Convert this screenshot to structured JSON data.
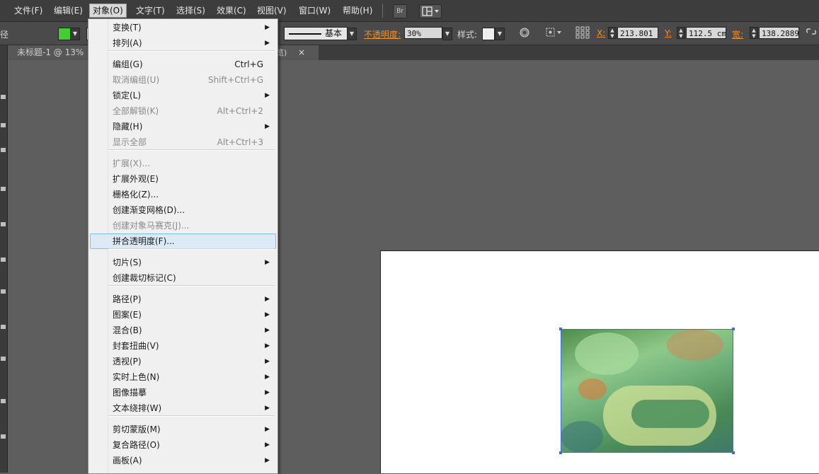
{
  "menubar": {
    "items": [
      "文件(F)",
      "编辑(E)",
      "对象(O)",
      "文字(T)",
      "选择(S)",
      "效果(C)",
      "视图(V)",
      "窗口(W)",
      "帮助(H)"
    ],
    "br_label": "Br"
  },
  "control": {
    "left_label": "径",
    "stroke_style": "基本",
    "opacity_label": "不透明度:",
    "opacity_value": "30%",
    "style_label": "样式:",
    "x_label": "X:",
    "x_value": "213.801",
    "y_label": "Y:",
    "y_value": "112.5 cm",
    "w_label": "宽:",
    "w_value": "138.2889",
    "fill_color": "#44cc33"
  },
  "doc": {
    "tab_title": "未标题-1 @ 13%",
    "tab2_fragment": "览)",
    "close_glyph": "×"
  },
  "menu": {
    "items": [
      {
        "label": "变换(T)",
        "shortcut": "",
        "submenu": true,
        "disabled": false
      },
      {
        "label": "排列(A)",
        "shortcut": "",
        "submenu": true,
        "disabled": false
      },
      {
        "label": "编组(G)",
        "shortcut": "Ctrl+G",
        "submenu": false,
        "disabled": false
      },
      {
        "label": "取消编组(U)",
        "shortcut": "Shift+Ctrl+G",
        "submenu": false,
        "disabled": true
      },
      {
        "label": "锁定(L)",
        "shortcut": "",
        "submenu": true,
        "disabled": false
      },
      {
        "label": "全部解锁(K)",
        "shortcut": "Alt+Ctrl+2",
        "submenu": false,
        "disabled": true
      },
      {
        "label": "隐藏(H)",
        "shortcut": "",
        "submenu": true,
        "disabled": false
      },
      {
        "label": "显示全部",
        "shortcut": "Alt+Ctrl+3",
        "submenu": false,
        "disabled": true
      },
      {
        "label": "扩展(X)...",
        "shortcut": "",
        "submenu": false,
        "disabled": true
      },
      {
        "label": "扩展外观(E)",
        "shortcut": "",
        "submenu": false,
        "disabled": false
      },
      {
        "label": "栅格化(Z)...",
        "shortcut": "",
        "submenu": false,
        "disabled": false
      },
      {
        "label": "创建渐变网格(D)...",
        "shortcut": "",
        "submenu": false,
        "disabled": false
      },
      {
        "label": "创建对象马赛克(J)...",
        "shortcut": "",
        "submenu": false,
        "disabled": true
      },
      {
        "label": "拼合透明度(F)...",
        "shortcut": "",
        "submenu": false,
        "disabled": false,
        "highlighted": true
      },
      {
        "label": "切片(S)",
        "shortcut": "",
        "submenu": true,
        "disabled": false
      },
      {
        "label": "创建裁切标记(C)",
        "shortcut": "",
        "submenu": false,
        "disabled": false
      },
      {
        "label": "路径(P)",
        "shortcut": "",
        "submenu": true,
        "disabled": false
      },
      {
        "label": "图案(E)",
        "shortcut": "",
        "submenu": true,
        "disabled": false
      },
      {
        "label": "混合(B)",
        "shortcut": "",
        "submenu": true,
        "disabled": false
      },
      {
        "label": "封套扭曲(V)",
        "shortcut": "",
        "submenu": true,
        "disabled": false
      },
      {
        "label": "透视(P)",
        "shortcut": "",
        "submenu": true,
        "disabled": false
      },
      {
        "label": "实时上色(N)",
        "shortcut": "",
        "submenu": true,
        "disabled": false
      },
      {
        "label": "图像描摹",
        "shortcut": "",
        "submenu": true,
        "disabled": false
      },
      {
        "label": "文本绕排(W)",
        "shortcut": "",
        "submenu": true,
        "disabled": false
      },
      {
        "label": "剪切蒙版(M)",
        "shortcut": "",
        "submenu": true,
        "disabled": false
      },
      {
        "label": "复合路径(O)",
        "shortcut": "",
        "submenu": true,
        "disabled": false
      },
      {
        "label": "画板(A)",
        "shortcut": "",
        "submenu": true,
        "disabled": false
      }
    ],
    "arrow_glyph": "▶"
  }
}
